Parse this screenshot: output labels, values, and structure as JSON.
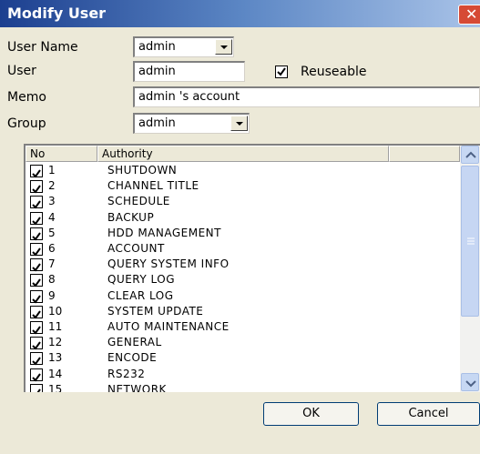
{
  "window": {
    "title": "Modify User",
    "close_glyph": "✕"
  },
  "form": {
    "user_name_label": "User Name",
    "user_name_value": "admin",
    "user_label": "User",
    "user_value": "admin",
    "reuseable_label": "Reuseable",
    "reuseable_checked": true,
    "memo_label": "Memo",
    "memo_value": "admin 's account",
    "group_label": "Group",
    "group_value": "admin"
  },
  "authority_list": {
    "columns": [
      "No",
      "Authority"
    ],
    "rows": [
      {
        "no": "1",
        "authority": "SHUTDOWN",
        "checked": true
      },
      {
        "no": "2",
        "authority": "CHANNEL TITLE",
        "checked": true
      },
      {
        "no": "3",
        "authority": "SCHEDULE",
        "checked": true
      },
      {
        "no": "4",
        "authority": "BACKUP",
        "checked": true
      },
      {
        "no": "5",
        "authority": "HDD MANAGEMENT",
        "checked": true
      },
      {
        "no": "6",
        "authority": "ACCOUNT",
        "checked": true
      },
      {
        "no": "7",
        "authority": "QUERY SYSTEM INFO",
        "checked": true
      },
      {
        "no": "8",
        "authority": "QUERY LOG",
        "checked": true
      },
      {
        "no": "9",
        "authority": "CLEAR LOG",
        "checked": true
      },
      {
        "no": "10",
        "authority": "SYSTEM UPDATE",
        "checked": true
      },
      {
        "no": "11",
        "authority": "AUTO MAINTENANCE",
        "checked": true
      },
      {
        "no": "12",
        "authority": "GENERAL",
        "checked": true
      },
      {
        "no": "13",
        "authority": "ENCODE",
        "checked": true
      },
      {
        "no": "14",
        "authority": "RS232",
        "checked": true
      },
      {
        "no": "15",
        "authority": "NETWORK",
        "checked": true
      }
    ]
  },
  "buttons": {
    "ok": "OK",
    "cancel": "Cancel"
  }
}
